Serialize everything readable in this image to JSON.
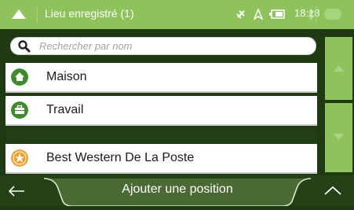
{
  "header": {
    "title": "Lieu enregistré (1)",
    "time": "18:18"
  },
  "search": {
    "placeholder": "Rechercher par nom",
    "value": ""
  },
  "places": [
    {
      "label": "Maison",
      "icon": "home-icon",
      "color": "#3d8c2a"
    },
    {
      "label": "Travail",
      "icon": "briefcase-icon",
      "color": "#3d8c2a"
    }
  ],
  "other": [
    {
      "label": "Best Western De La Poste",
      "icon": "star-icon",
      "color": "#f0a02e"
    }
  ],
  "footer": {
    "add_label": "Ajouter une position"
  },
  "colors": {
    "accent": "#8dc35a",
    "background": "#1f3a12"
  }
}
